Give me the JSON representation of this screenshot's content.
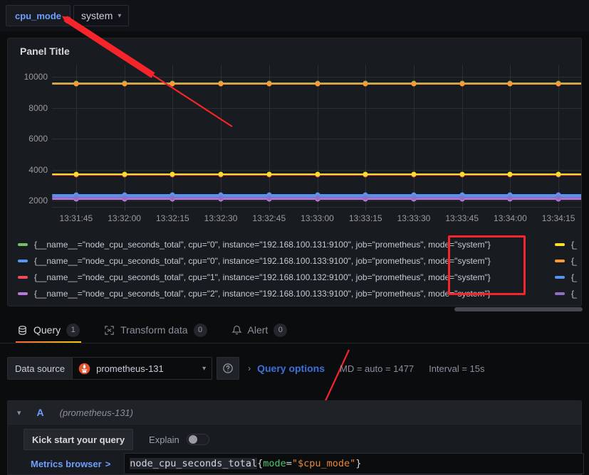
{
  "variables": [
    {
      "name": "cpu_mode",
      "value": "system",
      "chevron": "chevron-down-icon"
    }
  ],
  "panel": {
    "title": "Panel Title"
  },
  "chart_data": {
    "type": "line",
    "title": "Panel Title",
    "xlabel": "",
    "ylabel": "",
    "ylim": [
      1600,
      10800
    ],
    "yticks": [
      2000,
      4000,
      6000,
      8000,
      10000
    ],
    "grid": true,
    "legend_position": "bottom",
    "x": [
      "13:31:45",
      "13:32:00",
      "13:32:15",
      "13:32:30",
      "13:32:45",
      "13:33:00",
      "13:33:15",
      "13:33:30",
      "13:33:45",
      "13:34:00",
      "13:34:15"
    ],
    "series": [
      {
        "name": "{__name__=\"node_cpu_seconds_total\", cpu=\"0\", instance=\"192.168.100.131:9100\", job=\"prometheus\", mode=\"system\"}",
        "color": "#73bf69",
        "value": 9600
      },
      {
        "name": "{__name__=\"node_cpu_seconds_total\", cpu=\"0\", instance=\"192.168.100.133:9100\", job=\"prometheus\", mode=\"system\"}",
        "color": "#5794f2",
        "value": 2390
      },
      {
        "name": "{__name__=\"node_cpu_seconds_total\", cpu=\"1\", instance=\"192.168.100.132:9100\", job=\"prometheus\", mode=\"system\"}",
        "color": "#f2495c",
        "value": 3650
      },
      {
        "name": "{__name__=\"node_cpu_seconds_total\", cpu=\"2\", instance=\"192.168.100.133:9100\", job=\"prometheus\", mode=\"system\"}",
        "color": "#b877d9",
        "value": 2110
      },
      {
        "name": "{__name__=",
        "color": "#fade2a",
        "value": 3720
      },
      {
        "name": "{__name__=",
        "color": "#ff9830",
        "value": 9550
      },
      {
        "name": "{__name__=",
        "color": "#5794f2",
        "value": 2300
      },
      {
        "name": "{__name__=",
        "color": "#8f6fc4",
        "value": 2180
      }
    ]
  },
  "legend": {
    "column1": [
      {
        "color": "#73bf69",
        "text": "{__name__=\"node_cpu_seconds_total\", cpu=\"0\", instance=\"192.168.100.131:9100\", job=\"prometheus\", mode=\"system\"}"
      },
      {
        "color": "#5794f2",
        "text": "{__name__=\"node_cpu_seconds_total\", cpu=\"0\", instance=\"192.168.100.133:9100\", job=\"prometheus\", mode=\"system\"}"
      },
      {
        "color": "#f2495c",
        "text": "{__name__=\"node_cpu_seconds_total\", cpu=\"1\", instance=\"192.168.100.132:9100\", job=\"prometheus\", mode=\"system\"}"
      },
      {
        "color": "#b877d9",
        "text": "{__name__=\"node_cpu_seconds_total\", cpu=\"2\", instance=\"192.168.100.133:9100\", job=\"prometheus\", mode=\"system\"}"
      }
    ],
    "column2": [
      {
        "color": "#fade2a",
        "text": "{__name__="
      },
      {
        "color": "#ff9830",
        "text": "{__name__="
      },
      {
        "color": "#5794f2",
        "text": "{__name__="
      },
      {
        "color": "#8f6fc4",
        "text": "{__name__="
      }
    ]
  },
  "tabs": [
    {
      "label": "Query",
      "count": "1",
      "icon": "database-icon",
      "active": true
    },
    {
      "label": "Transform data",
      "count": "0",
      "icon": "transform-icon",
      "active": false
    },
    {
      "label": "Alert",
      "count": "0",
      "icon": "bell-icon",
      "active": false
    }
  ],
  "datasource": {
    "label": "Data source",
    "name": "prometheus-131",
    "icon": "prometheus-logo-icon",
    "chevron": "chevron-down-icon",
    "help_icon": "help-circle-icon"
  },
  "query_options": {
    "expand_icon": "chevron-right-icon",
    "title": "Query options",
    "max_data_points": "MD = auto = 1477",
    "interval": "Interval = 15s"
  },
  "query": {
    "collapse_icon": "chevron-down-icon",
    "ref_id": "A",
    "datasource_name": "(prometheus-131)",
    "kick_start_label": "Kick start your query",
    "explain_label": "Explain",
    "explain_on": false,
    "metrics_browser_label": "Metrics browser",
    "metrics_browser_chevron": ">",
    "expression": "node_cpu_seconds_total{mode=\"$cpu_mode\"}",
    "expr_tokens": {
      "metric": "node_cpu_seconds_total",
      "open_brace": "{",
      "label": "mode",
      "equals": "=",
      "value": "\"$cpu_mode\"",
      "close_brace": "}"
    }
  },
  "annotations": {
    "highlight_color": "#f5252b",
    "arrow_color": "#f5252b"
  }
}
